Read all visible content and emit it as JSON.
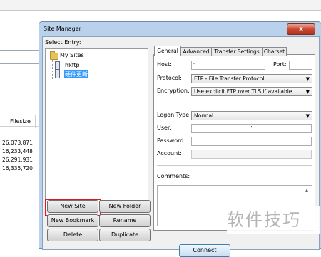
{
  "background": {
    "filesize_header": "Filesize",
    "sizes": [
      "26,073,871",
      "16,233,448",
      "26,291,931",
      "16,335,720"
    ]
  },
  "dialog": {
    "title": "Site Manager",
    "close_label": "x",
    "select_entry_label": "Select Entry:",
    "tree": {
      "root": "My Sites",
      "children": [
        "hkftp",
        "硬件更新"
      ],
      "selected": "硬件更新"
    },
    "buttons": {
      "new_site": "New Site",
      "new_folder": "New Folder",
      "new_bookmark": "New Bookmark",
      "rename": "Rename",
      "delete": "Delete",
      "duplicate": "Duplicate",
      "connect": "Connect"
    },
    "tabs": [
      "General",
      "Advanced",
      "Transfer Settings",
      "Charset"
    ],
    "active_tab": "General",
    "fields": {
      "host_label": "Host:",
      "host_value": "'",
      "port_label": "Port:",
      "port_value": "",
      "protocol_label": "Protocol:",
      "protocol_value": "FTP - File Transfer Protocol",
      "encryption_label": "Encryption:",
      "encryption_value": "Use explicit FTP over TLS if available",
      "logon_type_label": "Logon Type:",
      "logon_type_value": "Normal",
      "user_label": "User:",
      "user_value": "',",
      "password_label": "Password:",
      "password_value": "",
      "account_label": "Account:",
      "account_value": "",
      "comments_label": "Comments:"
    }
  },
  "watermark": "软件技巧"
}
